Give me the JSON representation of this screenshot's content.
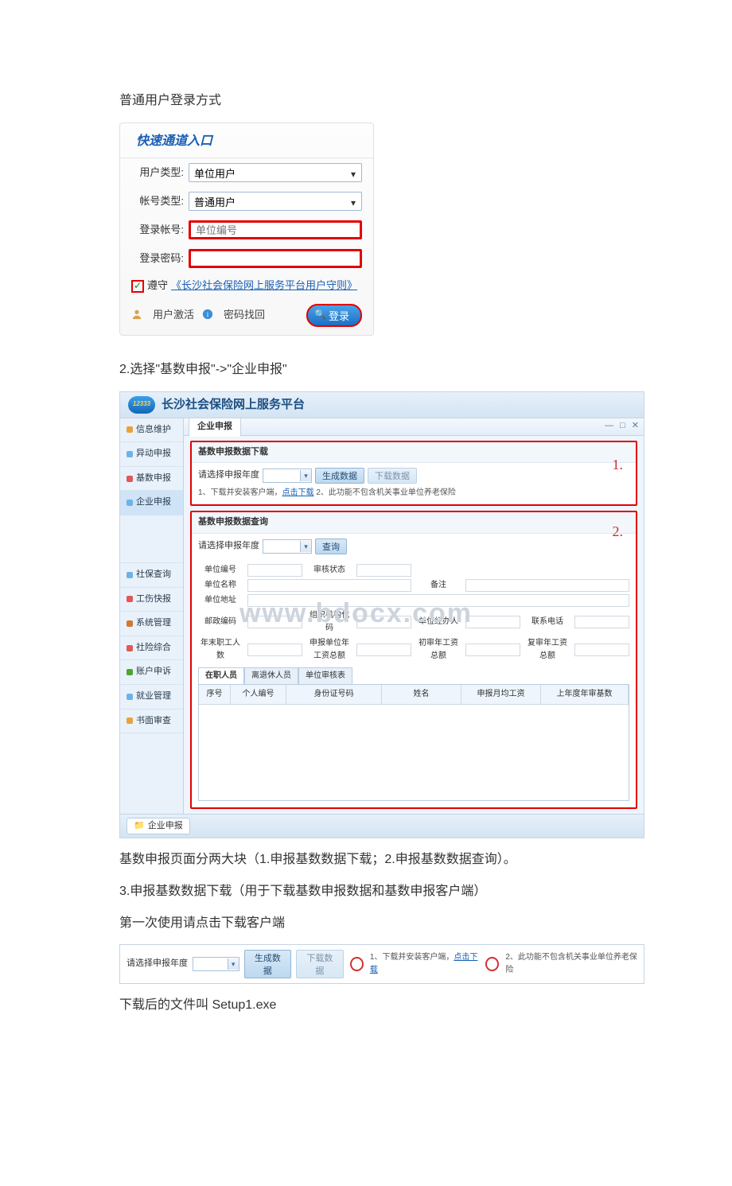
{
  "doc": {
    "para_login_method": "普通用户登录方式",
    "para_step2": "2.选择\"基数申报\"->\"企业申报\"",
    "para_note": "基数申报页面分两大块（1.申报基数数据下载；2.申报基数数据查询）。",
    "para_step3a": "3.申报基数数据下载（用于下载基数申报数据和基数申报客户端）",
    "para_step3b": "第一次使用请点击下载客户端",
    "para_after_dl": "下载后的文件叫 Setup1.exe"
  },
  "login": {
    "title": "快速通道入口",
    "labels": {
      "user_type": "用户类型:",
      "acct_type": "帐号类型:",
      "acct": "登录帐号:",
      "pwd": "登录密码:"
    },
    "user_type_value": "单位用户",
    "acct_type_value": "普通用户",
    "acct_placeholder": "单位编号",
    "agree_prefix": "遵守",
    "agree_link": "《长沙社会保险网上服务平台用户守则》",
    "actions": {
      "activate": "用户激活",
      "forgot": "密码找回",
      "login": "登录"
    }
  },
  "app": {
    "logo_text": "12333",
    "title": "长沙社会保险网上服务平台",
    "sidebar": {
      "items": [
        "信息维护",
        "异动申报",
        "基数申报",
        "企业申报",
        "社保查询",
        "工伤快报",
        "系统管理",
        "社险综合",
        "账户申诉",
        "就业管理",
        "书面审查"
      ]
    },
    "tab_active": "企业申报",
    "footer_tab": "企业申报",
    "sec1": {
      "title": "基数申报数据下载",
      "label_year": "请选择申报年度",
      "btn_gen": "生成数据",
      "btn_dl": "下载数据",
      "hint_prefix": "1、下载并安装客户端，",
      "hint_link": "点击下载",
      "hint_suffix": " 2、此功能不包含机关事业单位养老保险",
      "tag": "1."
    },
    "sec2": {
      "title": "基数申报数据查询",
      "label_year": "请选择申报年度",
      "btn_query": "查询",
      "tag": "2.",
      "fields": {
        "unit_no": "单位编号",
        "audit": "审核状态",
        "unit_name": "单位名称",
        "remark": "备注",
        "unit_addr": "单位地址",
        "post": "邮政编码",
        "org_code": "组织机构代码",
        "agent": "单位经办人",
        "phone": "联系电话",
        "year_end_emp": "年末职工人数",
        "rpt_unit_total": "申报单位年工资总额",
        "init_total": "初审年工资总额",
        "reaudit_total": "复审年工资总额"
      }
    },
    "subtabs": [
      "在职人员",
      "离退休人员",
      "单位审核表"
    ],
    "grid_cols": [
      "序号",
      "个人编号",
      "身份证号码",
      "姓名",
      "申报月均工资",
      "上年度年审基数"
    ],
    "watermark": "www.bdocx.com"
  },
  "dlbar": {
    "label_year": "请选择申报年度",
    "btn_gen": "生成数据",
    "btn_dl": "下载数据",
    "hint_prefix": "1、下载并安装客户端，",
    "hint_link": "点击下载",
    "hint_suffix": " 2、此功能不包含机关事业单位养老保险"
  }
}
